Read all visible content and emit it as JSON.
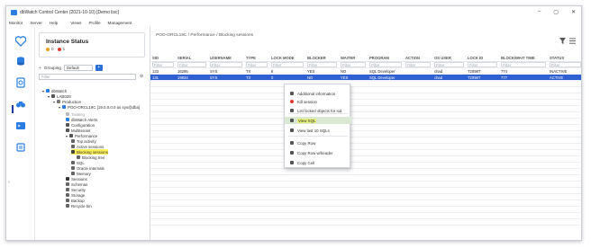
{
  "window": {
    "title": "dbWatch Control Center  (2021-10-10)  [Demo lisc]",
    "controls": [
      "–",
      "▢",
      "✕"
    ]
  },
  "menu": [
    "Monitor",
    "Server",
    "Help",
    "Views",
    "Profile",
    "Management"
  ],
  "status": {
    "title": "Instance Status",
    "ok_count": "0",
    "alarm_count": "1",
    "ok_color": "#f0a020",
    "alarm_color": "#e03a2c"
  },
  "grouping": {
    "label": "Grouping",
    "value": "Default",
    "button": "+"
  },
  "filter": {
    "placeholder": "Filter",
    "clear": "⊘"
  },
  "tree": [
    {
      "label": "dbWatch",
      "icon": "circle"
    },
    {
      "label": "LAB028",
      "icon": "server"
    },
    {
      "label": "Production",
      "icon": "folder"
    },
    {
      "label": "POO-ORCL19C [19.0.0.0.0 as sys@dba]",
      "icon": "db"
    },
    {
      "label": "Tasking",
      "icon": "task",
      "muted": true
    },
    {
      "label": "dbWatch Alerts",
      "icon": "alert"
    },
    {
      "label": "Configuration",
      "icon": "gear"
    },
    {
      "label": "Multitenant",
      "icon": "multi"
    },
    {
      "label": "Performance",
      "icon": "perf"
    },
    {
      "label": "Top activity",
      "icon": "chart"
    },
    {
      "label": "Active sessions",
      "icon": "sessions"
    },
    {
      "label": "Blocking sessions",
      "icon": "lock",
      "selected": true
    },
    {
      "label": "Blocking tree",
      "icon": "tree"
    },
    {
      "label": "SQL",
      "icon": "sql"
    },
    {
      "label": "Oracle internals",
      "icon": "internals"
    },
    {
      "label": "Memory",
      "icon": "memory"
    },
    {
      "label": "Sessions",
      "icon": "user"
    },
    {
      "label": "Schemas",
      "icon": "schema"
    },
    {
      "label": "Security",
      "icon": "shield"
    },
    {
      "label": "Storage",
      "icon": "storage"
    },
    {
      "label": "Backup",
      "icon": "backup"
    },
    {
      "label": "Recycle bin",
      "icon": "bin"
    }
  ],
  "main": {
    "breadcrumb": "POO-ORCL19C / Performance / Blocking sessions"
  },
  "table": {
    "columns": [
      "SID",
      "SERIAL",
      "USERNAME",
      "TYPE",
      "LOCK MODE",
      "BLOCKER",
      "WAITER",
      "PROGRAM",
      "ACTION",
      "OS USER",
      "LOCK ID",
      "BLOCK/WAIT TIME",
      "STATUS"
    ],
    "filter_label": "Filter",
    "rows": [
      [
        "133",
        "16295",
        "SYS",
        "TX",
        "6",
        "YES",
        "NO",
        "SQL Developer",
        "",
        "chad",
        "T2098T",
        "774",
        "INACTIVE"
      ],
      [
        "131",
        "19834",
        "SYS",
        "TX",
        "0",
        "NO",
        "YES",
        "SQL Developer",
        "",
        "chad",
        "T2098T",
        "777",
        "ACTIVE"
      ]
    ],
    "selected_row": 1
  },
  "context_menu": [
    {
      "label": "Additional information",
      "icon": "info"
    },
    {
      "label": "Kill session",
      "icon": "kill"
    },
    {
      "label": "List locked objects for sid",
      "icon": "list"
    },
    {
      "label": "View SQL",
      "icon": "sql",
      "highlight": true
    },
    {
      "label": "View last 10 SQLs",
      "icon": "sql10"
    },
    {
      "label": "Copy Row",
      "icon": "copy"
    },
    {
      "label": "Copy Row w/header",
      "icon": "copy"
    },
    {
      "label": "Copy Cell",
      "icon": "copy"
    }
  ]
}
